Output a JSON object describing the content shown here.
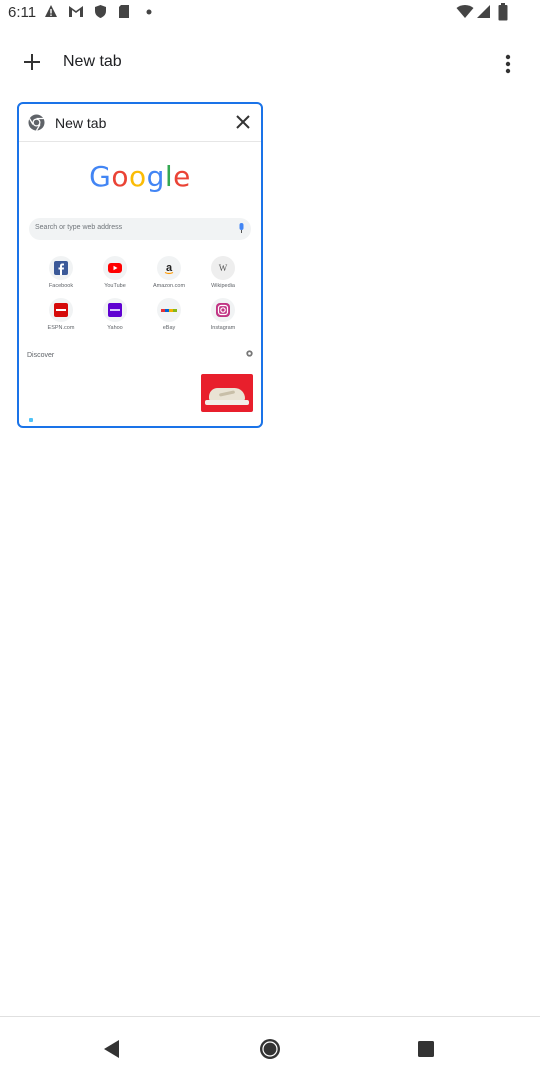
{
  "status_bar": {
    "time": "6:11",
    "icons_left": [
      "warning-icon",
      "gmail-icon",
      "shield-icon",
      "sd-card-icon",
      "dot-icon"
    ],
    "icons_right": [
      "wifi-icon",
      "signal-icon",
      "battery-icon"
    ]
  },
  "toolbar": {
    "title": "New tab",
    "new_tab_icon": "plus-icon",
    "menu_icon": "more-vert-icon"
  },
  "tab_card": {
    "title": "New tab",
    "favicon": "chrome-icon",
    "close_icon": "close-icon",
    "preview": {
      "logo_letters": [
        "G",
        "o",
        "o",
        "g",
        "l",
        "e"
      ],
      "logo_colors": [
        "#4285F4",
        "#EA4335",
        "#FBBC05",
        "#4285F4",
        "#34A853",
        "#EA4335"
      ],
      "search_placeholder": "Search or type web address",
      "tiles": [
        {
          "label": "Facebook",
          "icon": "facebook-icon",
          "color": "#3b5998"
        },
        {
          "label": "YouTube",
          "icon": "youtube-icon",
          "color": "#ff0000"
        },
        {
          "label": "Amazon.com",
          "icon": "amazon-icon",
          "color": "#222222"
        },
        {
          "label": "Wikipedia",
          "icon": "wikipedia-icon",
          "color": "#777777"
        },
        {
          "label": "ESPN.com",
          "icon": "espn-icon",
          "color": "#d50a0a"
        },
        {
          "label": "Yahoo",
          "icon": "yahoo-icon",
          "color": "#5f01d1"
        },
        {
          "label": "eBay",
          "icon": "ebay-icon",
          "color": "#e53238"
        },
        {
          "label": "Instagram",
          "icon": "instagram-icon",
          "color": "#c13584"
        }
      ],
      "discover_label": "Discover"
    }
  },
  "nav_bar": {
    "back_icon": "back-icon",
    "home_icon": "home-icon",
    "recents_icon": "recents-icon"
  },
  "colors": {
    "accent": "#1a73e8"
  }
}
